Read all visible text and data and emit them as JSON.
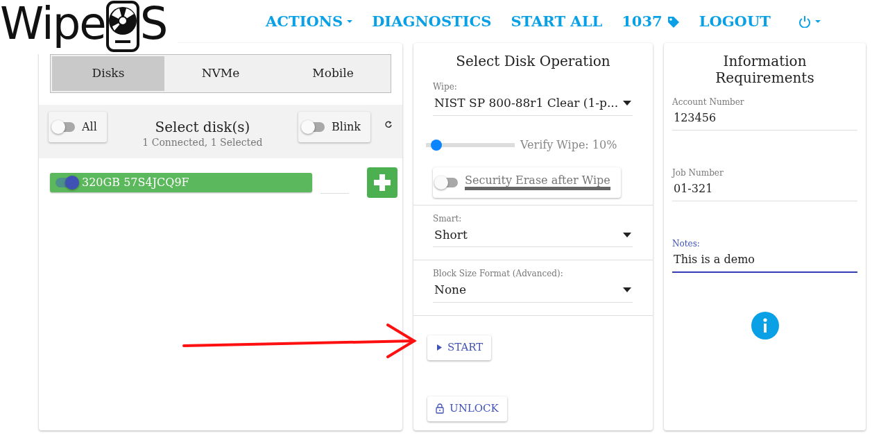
{
  "logo": {
    "text_before": "Wipe",
    "text_after": "S"
  },
  "nav": [
    {
      "kind": "dropdown",
      "label": "ACTIONS"
    },
    {
      "kind": "link",
      "label": "DIAGNOSTICS"
    },
    {
      "kind": "link",
      "label": "START ALL"
    },
    {
      "kind": "tag",
      "label": "1037"
    },
    {
      "kind": "link",
      "label": "LOGOUT"
    },
    {
      "kind": "power"
    }
  ],
  "disk_panel": {
    "tabs": [
      {
        "label": "Disks",
        "selected": true
      },
      {
        "label": "NVMe",
        "selected": false
      },
      {
        "label": "Mobile",
        "selected": false
      }
    ],
    "all_toggle": {
      "label": "All",
      "on": false
    },
    "title": "Select disk(s)",
    "subtitle": "1 Connected, 1 Selected",
    "blink_toggle": {
      "label": "Blink",
      "on": false
    },
    "disks": [
      {
        "label": "320GB 57S4JCQ9F",
        "on": true
      }
    ]
  },
  "operation_panel": {
    "title": "Select Disk Operation",
    "wipe": {
      "label": "Wipe:",
      "value": "NIST SP 800-88r1 Clear (1-p..."
    },
    "verify": {
      "level": 0.1,
      "reading": "Verify Wipe: 10%"
    },
    "security_erase": {
      "label": "Security Erase after Wipe",
      "on": false
    },
    "smart": {
      "label": "Smart:",
      "value": "Short"
    },
    "block_size": {
      "label": "Block Size Format (Advanced):",
      "value": "None"
    },
    "buttons": [
      {
        "kind": "start",
        "label": "START"
      },
      {
        "kind": "unlock",
        "label": "UNLOCK"
      }
    ]
  },
  "info_panel": {
    "title": "Information Requirements",
    "fields": [
      {
        "label": "Account Number",
        "value": "123456",
        "focused": false
      },
      {
        "label": "Job Number",
        "value": "01-321",
        "focused": false
      },
      {
        "label": "Notes:",
        "value": "This is a demo",
        "focused": true
      }
    ]
  }
}
